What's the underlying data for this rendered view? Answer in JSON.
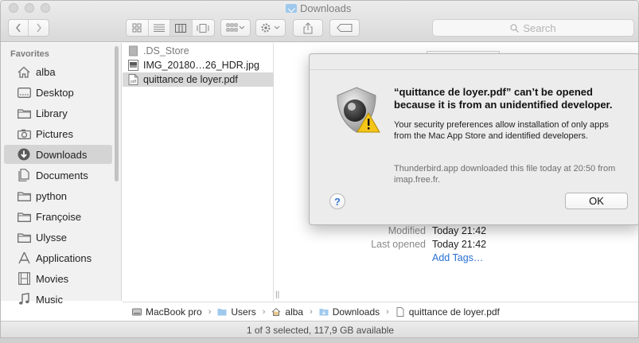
{
  "window": {
    "title": "Downloads"
  },
  "toolbar": {
    "search_placeholder": "Search"
  },
  "sidebar": {
    "header": "Favorites",
    "items": [
      {
        "label": "alba",
        "icon": "home-icon"
      },
      {
        "label": "Desktop",
        "icon": "desktop-icon"
      },
      {
        "label": "Library",
        "icon": "folder-icon"
      },
      {
        "label": "Pictures",
        "icon": "camera-icon"
      },
      {
        "label": "Downloads",
        "icon": "download-icon",
        "selected": true
      },
      {
        "label": "Documents",
        "icon": "document-icon"
      },
      {
        "label": "python",
        "icon": "folder-icon"
      },
      {
        "label": "Françoise",
        "icon": "folder-icon"
      },
      {
        "label": "Ulysse",
        "icon": "folder-icon"
      },
      {
        "label": "Applications",
        "icon": "applications-icon"
      },
      {
        "label": "Movies",
        "icon": "film-icon"
      },
      {
        "label": "Music",
        "icon": "music-icon"
      }
    ]
  },
  "files": [
    {
      "name": ".DS_Store",
      "icon": "generic-file-icon",
      "dimmed": true
    },
    {
      "name": "IMG_20180…26_HDR.jpg",
      "icon": "image-file-icon"
    },
    {
      "name": "quittance de loyer.pdf",
      "icon": "pdf-file-icon",
      "selected": true
    }
  ],
  "preview": {
    "modified_label": "Modified",
    "modified_value": "Today 21:42",
    "last_opened_label": "Last opened",
    "last_opened_value": "Today 21:42",
    "add_tags": "Add Tags…"
  },
  "pathbar": {
    "segments": [
      "MacBook pro",
      "Users",
      "alba",
      "Downloads",
      "quittance de loyer.pdf"
    ],
    "separator": "›"
  },
  "statusbar": {
    "text": "1 of 3 selected, 117,9 GB available"
  },
  "dialog": {
    "title": "“quittance de loyer.pdf” can’t be opened because it is from an unidentified developer.",
    "body": "Your security preferences allow installation of only apps from the Mac App Store and identified developers.",
    "note": "Thunderbird.app downloaded this file today at 20:50 from imap.free.fr.",
    "help_label": "?",
    "ok_label": "OK",
    "icon": "gatekeeper-lock-warning-icon"
  },
  "colors": {
    "selection": "#d4d4d4",
    "accent_blue": "#2a6fd4",
    "warning_yellow": "#f5c518"
  }
}
